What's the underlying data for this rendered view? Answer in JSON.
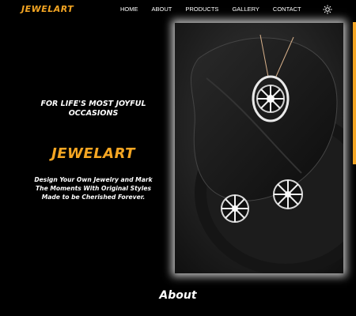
{
  "header": {
    "logo": "JEWELART",
    "nav": [
      "HOME",
      "ABOUT",
      "PRODUCTS",
      "GALLERY",
      "CONTACT"
    ],
    "theme_icon": "sun-icon"
  },
  "hero": {
    "tagline_line1": "FOR LIFE'S MOST JOYFUL",
    "tagline_line2": "OCCASIONS",
    "brand": "JEWELART",
    "desc_line1": "Design Your Own Jewelry and Mark",
    "desc_line2": "The Moments With Original Styles",
    "desc_line3": "Made to be Cherished Forever."
  },
  "about": {
    "title": "About"
  },
  "colors": {
    "accent": "#f5a623",
    "background": "#000000"
  }
}
